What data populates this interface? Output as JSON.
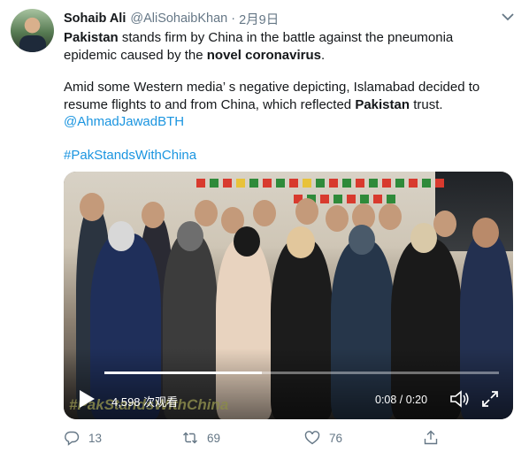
{
  "tweet": {
    "author_name": "Sohaib Ali",
    "handle": "@AliSohaibKhan",
    "separator": "·",
    "date": "2月9日",
    "text_line1_bold": "Pakistan",
    "text_line1_rest": " stands firm by China in the battle against the pneumonia",
    "text_line2_start": "epidemic caused by the ",
    "text_line2_bold": "novel coronavirus",
    "text_line2_end": ".",
    "para2_text": "Amid some Western media’ s negative depicting, Islamabad decided to resume flights to and from China, which reflected ",
    "para2_bold": "Pakistan",
    "para2_end": " trust.",
    "mention": "@AhmadJawadBTH",
    "hashtag": "#PakStandsWithChina"
  },
  "video": {
    "watermark": "#PakStandsWithChina",
    "views": "4,598 次观看",
    "time": "0:08 / 0:20",
    "progress": 0.4
  },
  "actions": {
    "replies": "13",
    "retweets": "69",
    "likes": "76"
  },
  "colors": {
    "link": "#1b95e0",
    "secondary_text": "#657786"
  },
  "icons": {
    "caret": "chevron-down-icon",
    "play": "play-icon",
    "volume": "volume-icon",
    "fullscreen": "fullscreen-icon",
    "reply": "reply-icon",
    "retweet": "retweet-icon",
    "like": "heart-icon",
    "share": "share-icon"
  }
}
